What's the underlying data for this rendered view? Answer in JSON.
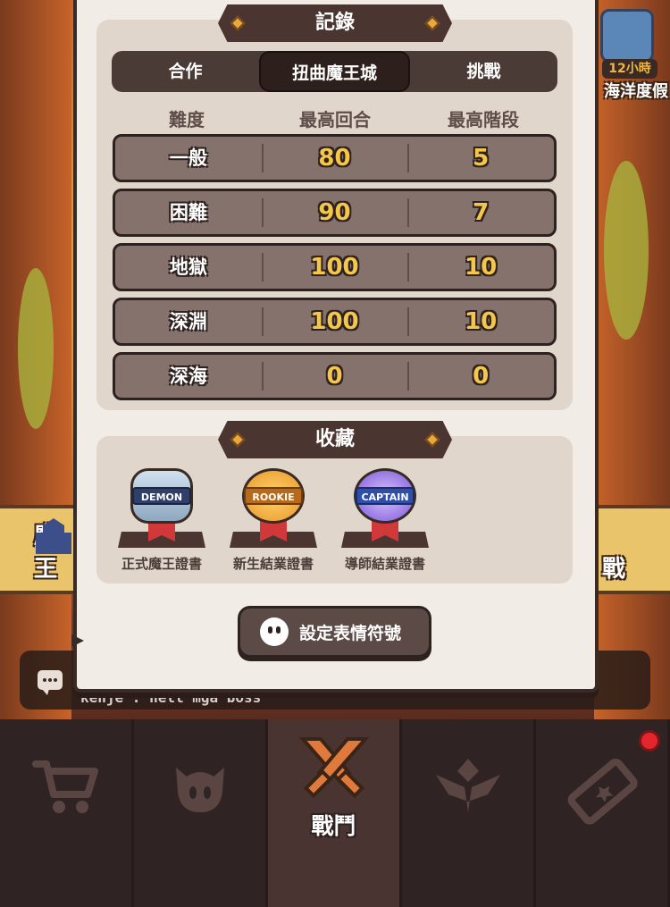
{
  "background": {
    "left_banner_label": "魔王",
    "right_banner_label": "戰",
    "event": {
      "timer": "12小時",
      "label": "海洋度假"
    }
  },
  "records": {
    "title": "記錄",
    "tabs": [
      {
        "label": "合作",
        "active": false
      },
      {
        "label": "扭曲魔王城",
        "active": true
      },
      {
        "label": "挑戰",
        "active": false
      }
    ],
    "columns": [
      "難度",
      "最高回合",
      "最高階段"
    ],
    "rows": [
      {
        "difficulty": "一般",
        "max_round": "80",
        "max_stage": "5"
      },
      {
        "difficulty": "困難",
        "max_round": "90",
        "max_stage": "7"
      },
      {
        "difficulty": "地獄",
        "max_round": "100",
        "max_stage": "10"
      },
      {
        "difficulty": "深淵",
        "max_round": "100",
        "max_stage": "10"
      },
      {
        "difficulty": "深海",
        "max_round": "0",
        "max_stage": "0"
      }
    ]
  },
  "collection": {
    "title": "收藏",
    "badges": [
      {
        "tag": "DEMON",
        "caption": "正式魔王證書"
      },
      {
        "tag": "ROOKIE",
        "caption": "新生結業證書"
      },
      {
        "tag": "CAPTAIN",
        "caption": "導師結業證書"
      }
    ]
  },
  "emote_button": {
    "label": "設定表情符號"
  },
  "chat": {
    "message": "kenje : hell mga boss"
  },
  "nav": {
    "items": [
      {
        "name": "shop",
        "icon": "cart-icon"
      },
      {
        "name": "monster",
        "icon": "monster-face-icon"
      },
      {
        "name": "battle",
        "icon": "crossed-swords-icon",
        "label": "戰鬥",
        "active": true
      },
      {
        "name": "rank",
        "icon": "rank-wings-icon"
      },
      {
        "name": "ticket",
        "icon": "ticket-icon",
        "notification": true
      }
    ]
  },
  "colors": {
    "panel": "#f1ece6",
    "row": "#85726c",
    "number": "#f4c74a",
    "dark": "#2e2220"
  }
}
